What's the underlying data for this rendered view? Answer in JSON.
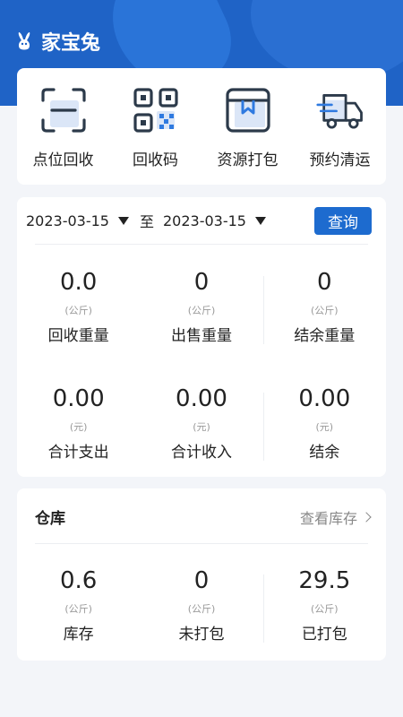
{
  "app": {
    "title": "家宝兔",
    "brand_icon": "rabbit-icon"
  },
  "colors": {
    "primary": "#1f63c6",
    "button": "#1d6bcf"
  },
  "actions": [
    {
      "label": "点位回收",
      "icon": "scan-icon"
    },
    {
      "label": "回收码",
      "icon": "qr-code-icon"
    },
    {
      "label": "资源打包",
      "icon": "package-box-icon"
    },
    {
      "label": "预约清运",
      "icon": "truck-icon"
    }
  ],
  "date_filter": {
    "start": "2023-03-15",
    "to": "至",
    "end": "2023-03-15",
    "query_label": "查询"
  },
  "weight_stats": [
    {
      "value": "0.0",
      "unit": "(公斤)",
      "label": "回收重量"
    },
    {
      "value": "0",
      "unit": "(公斤)",
      "label": "出售重量"
    },
    {
      "value": "0",
      "unit": "(公斤)",
      "label": "结余重量"
    }
  ],
  "money_stats": [
    {
      "value": "0.00",
      "unit": "(元)",
      "label": "合计支出"
    },
    {
      "value": "0.00",
      "unit": "(元)",
      "label": "合计收入"
    },
    {
      "value": "0.00",
      "unit": "(元)",
      "label": "结余"
    }
  ],
  "warehouse": {
    "title": "仓库",
    "link": "查看库存",
    "stats": [
      {
        "value": "0.6",
        "unit": "(公斤)",
        "label": "库存"
      },
      {
        "value": "0",
        "unit": "(公斤)",
        "label": "未打包"
      },
      {
        "value": "29.5",
        "unit": "(公斤)",
        "label": "已打包"
      }
    ]
  }
}
